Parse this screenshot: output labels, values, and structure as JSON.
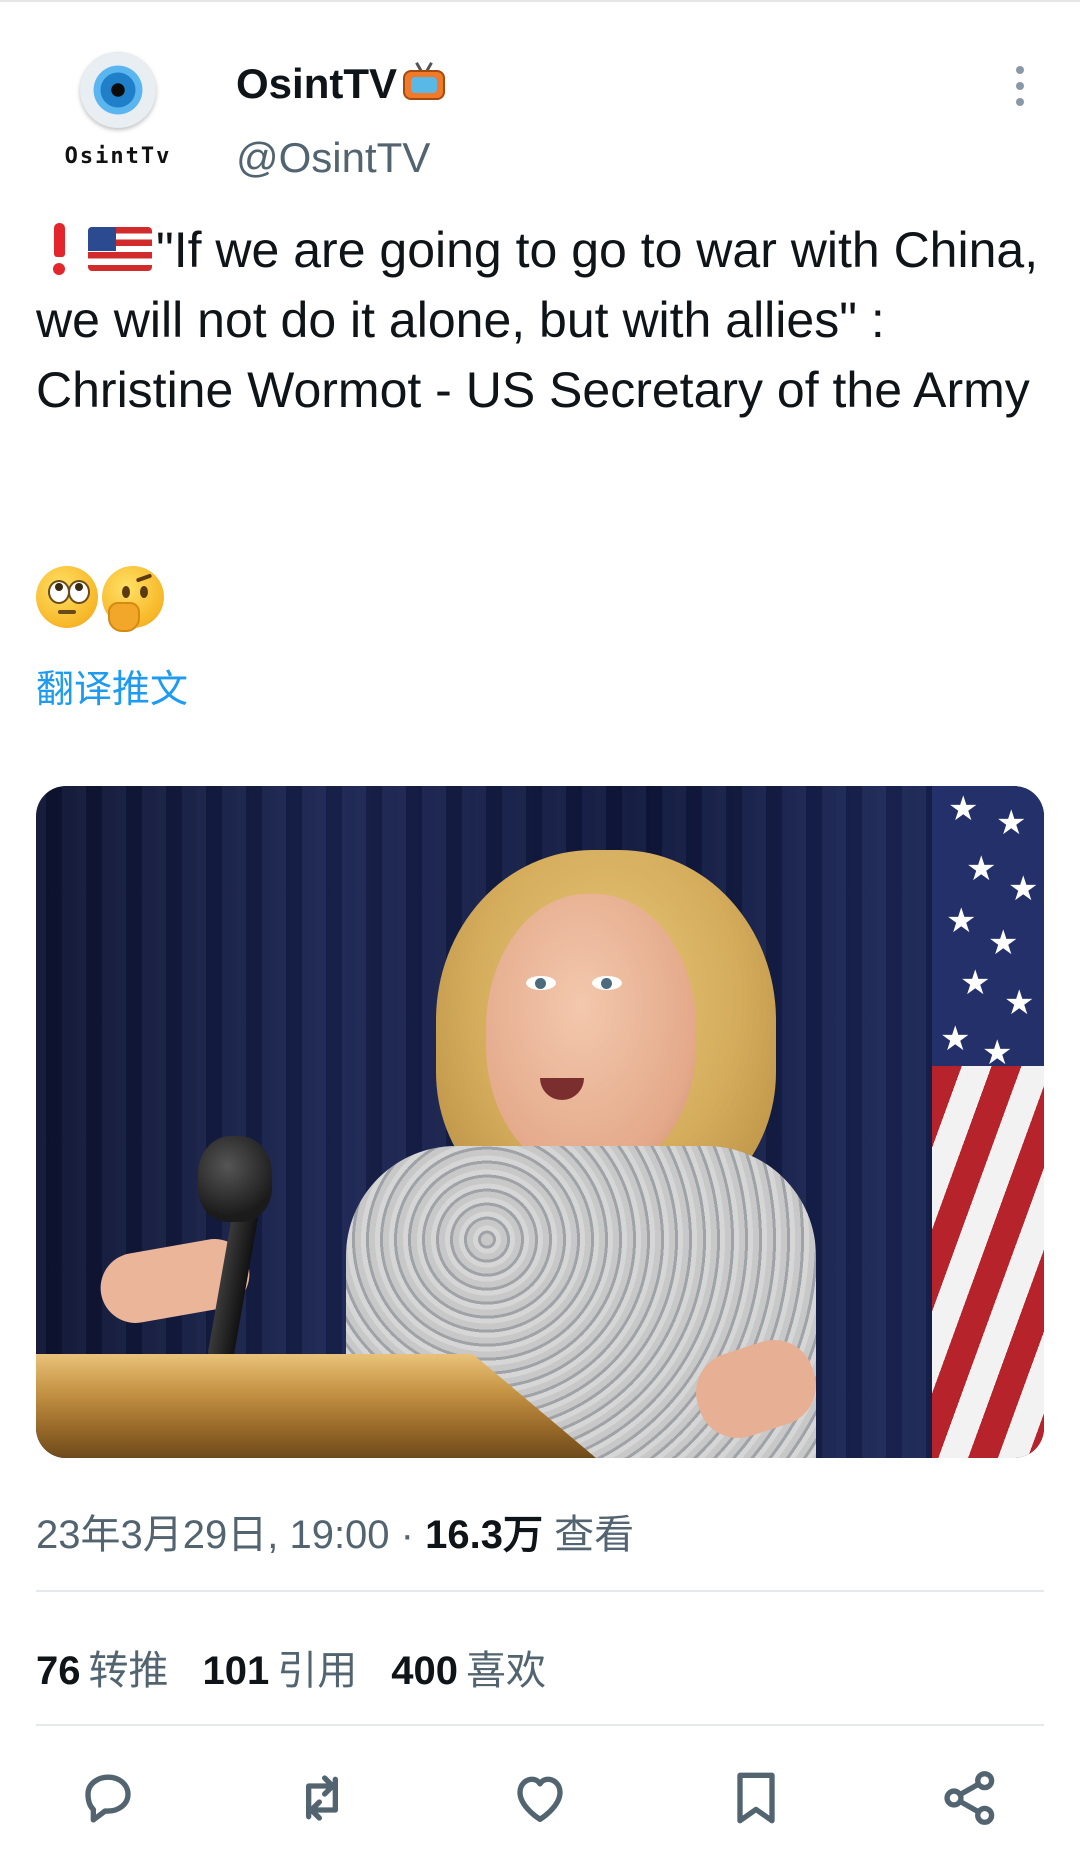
{
  "account": {
    "avatar_text": "OsintTv",
    "name": "OsintTV",
    "handle": "@OsintTV"
  },
  "tweet": {
    "text": "\"If we are going to go to war with China, we will not do it alone, but with allies\" : Christine Wormot - US Secretary of the Army",
    "leading_icons": [
      "red-exclamation-icon",
      "us-flag-icon"
    ],
    "trailing_emojis": [
      "face-with-rolling-eyes-icon",
      "thinking-face-icon"
    ],
    "translate_link": "翻译推文"
  },
  "media": {
    "description_icon": "speaker-at-podium-photo"
  },
  "meta": {
    "datetime": "23年3月29日, 19:00",
    "separator": " · ",
    "views_count": "16.3万",
    "views_label": " 查看"
  },
  "stats": {
    "retweets_count": "76",
    "retweets_label": "转推",
    "quotes_count": "101",
    "quotes_label": "引用",
    "likes_count": "400",
    "likes_label": "喜欢"
  },
  "actions": [
    "reply-icon",
    "retweet-icon",
    "like-icon",
    "bookmark-icon",
    "share-icon"
  ],
  "colors": {
    "link": "#1d9bf0",
    "secondary_text": "#536471",
    "primary_text": "#0f1419"
  }
}
